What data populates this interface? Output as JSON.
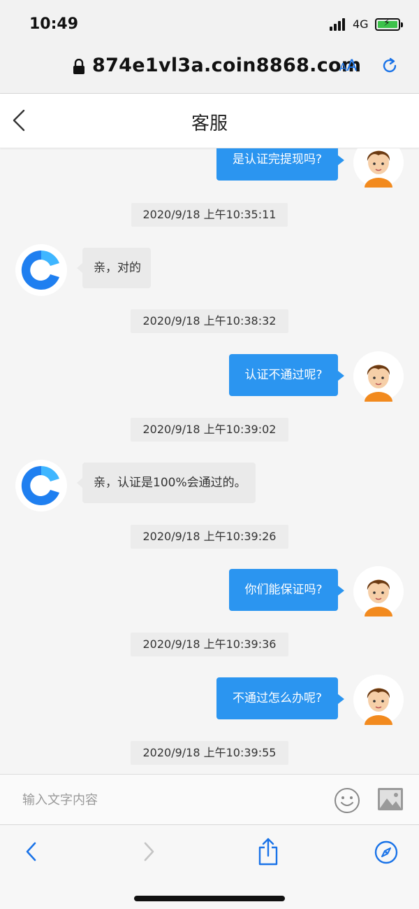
{
  "status_bar": {
    "time": "10:49",
    "network": "4G"
  },
  "browser": {
    "url": "874e1vl3a.coin8868.com",
    "text_size_label": "AA"
  },
  "header": {
    "title": "客服"
  },
  "messages": [
    {
      "type": "sent",
      "text": "是认证完提现吗?"
    },
    {
      "type": "timestamp",
      "text": "2020/9/18 上午10:35:11"
    },
    {
      "type": "received",
      "text": "亲，对的"
    },
    {
      "type": "timestamp",
      "text": "2020/9/18 上午10:38:32"
    },
    {
      "type": "sent",
      "text": "认证不通过呢?"
    },
    {
      "type": "timestamp",
      "text": "2020/9/18 上午10:39:02"
    },
    {
      "type": "received",
      "text": "亲，认证是100%会通过的。"
    },
    {
      "type": "timestamp",
      "text": "2020/9/18 上午10:39:26"
    },
    {
      "type": "sent",
      "text": "你们能保证吗?"
    },
    {
      "type": "timestamp",
      "text": "2020/9/18 上午10:39:36"
    },
    {
      "type": "sent",
      "text": "不通过怎么办呢?"
    },
    {
      "type": "timestamp",
      "text": "2020/9/18 上午10:39:55"
    }
  ],
  "input": {
    "placeholder": "输入文字内容"
  },
  "colors": {
    "accent": "#2b95f0",
    "browser_blue": "#1a73e8",
    "service_logo": "#1f7ff0"
  },
  "icons": {
    "status": [
      "signal-icon",
      "battery-icon"
    ],
    "browser": [
      "lock-icon",
      "text-size-icon",
      "reload-icon"
    ],
    "nav": [
      "back-arrow-icon"
    ],
    "input": [
      "emoji-icon",
      "image-icon"
    ],
    "toolbar": [
      "back-icon",
      "forward-icon",
      "share-icon",
      "compass-icon"
    ]
  }
}
